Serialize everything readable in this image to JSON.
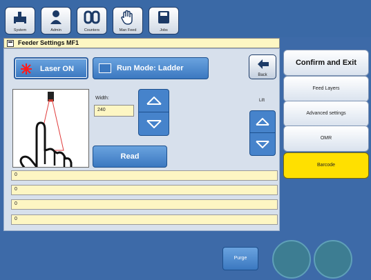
{
  "toolbar": {
    "items": [
      {
        "label": "System",
        "icon": "system-icon"
      },
      {
        "label": "Admin",
        "icon": "admin-icon"
      },
      {
        "label": "Counters",
        "icon": "counters-icon"
      },
      {
        "label": "Man Feed",
        "icon": "hand-icon"
      },
      {
        "label": "Jobs",
        "icon": "jobs-icon"
      }
    ]
  },
  "title": "Feeder Settings MF1",
  "laser": {
    "label": "Laser ON",
    "icon": "laser-icon"
  },
  "run_mode": {
    "label": "Run Mode: Ladder",
    "icon": "run-mode-icon"
  },
  "back": {
    "label": "Back",
    "icon": "back-arrow-icon"
  },
  "width": {
    "label": "Width:",
    "value": "240"
  },
  "lift": {
    "label": "Lift"
  },
  "read_button": {
    "label": "Read"
  },
  "readouts": [
    "0",
    "0",
    "0",
    "0"
  ],
  "side_menu": {
    "confirm": "Confirm and Exit",
    "feed_layers": "Feed Layers",
    "advanced": "Advanced settings",
    "omr": "OMR",
    "barcode": "Barcode"
  },
  "purge": {
    "label": "Purge"
  },
  "colors": {
    "background": "#3d6aa8",
    "panel": "#d7e0ec",
    "button_blue": "#4683cb",
    "input_yellow": "#fdf6c3",
    "barcode_selected": "#ffe000"
  }
}
